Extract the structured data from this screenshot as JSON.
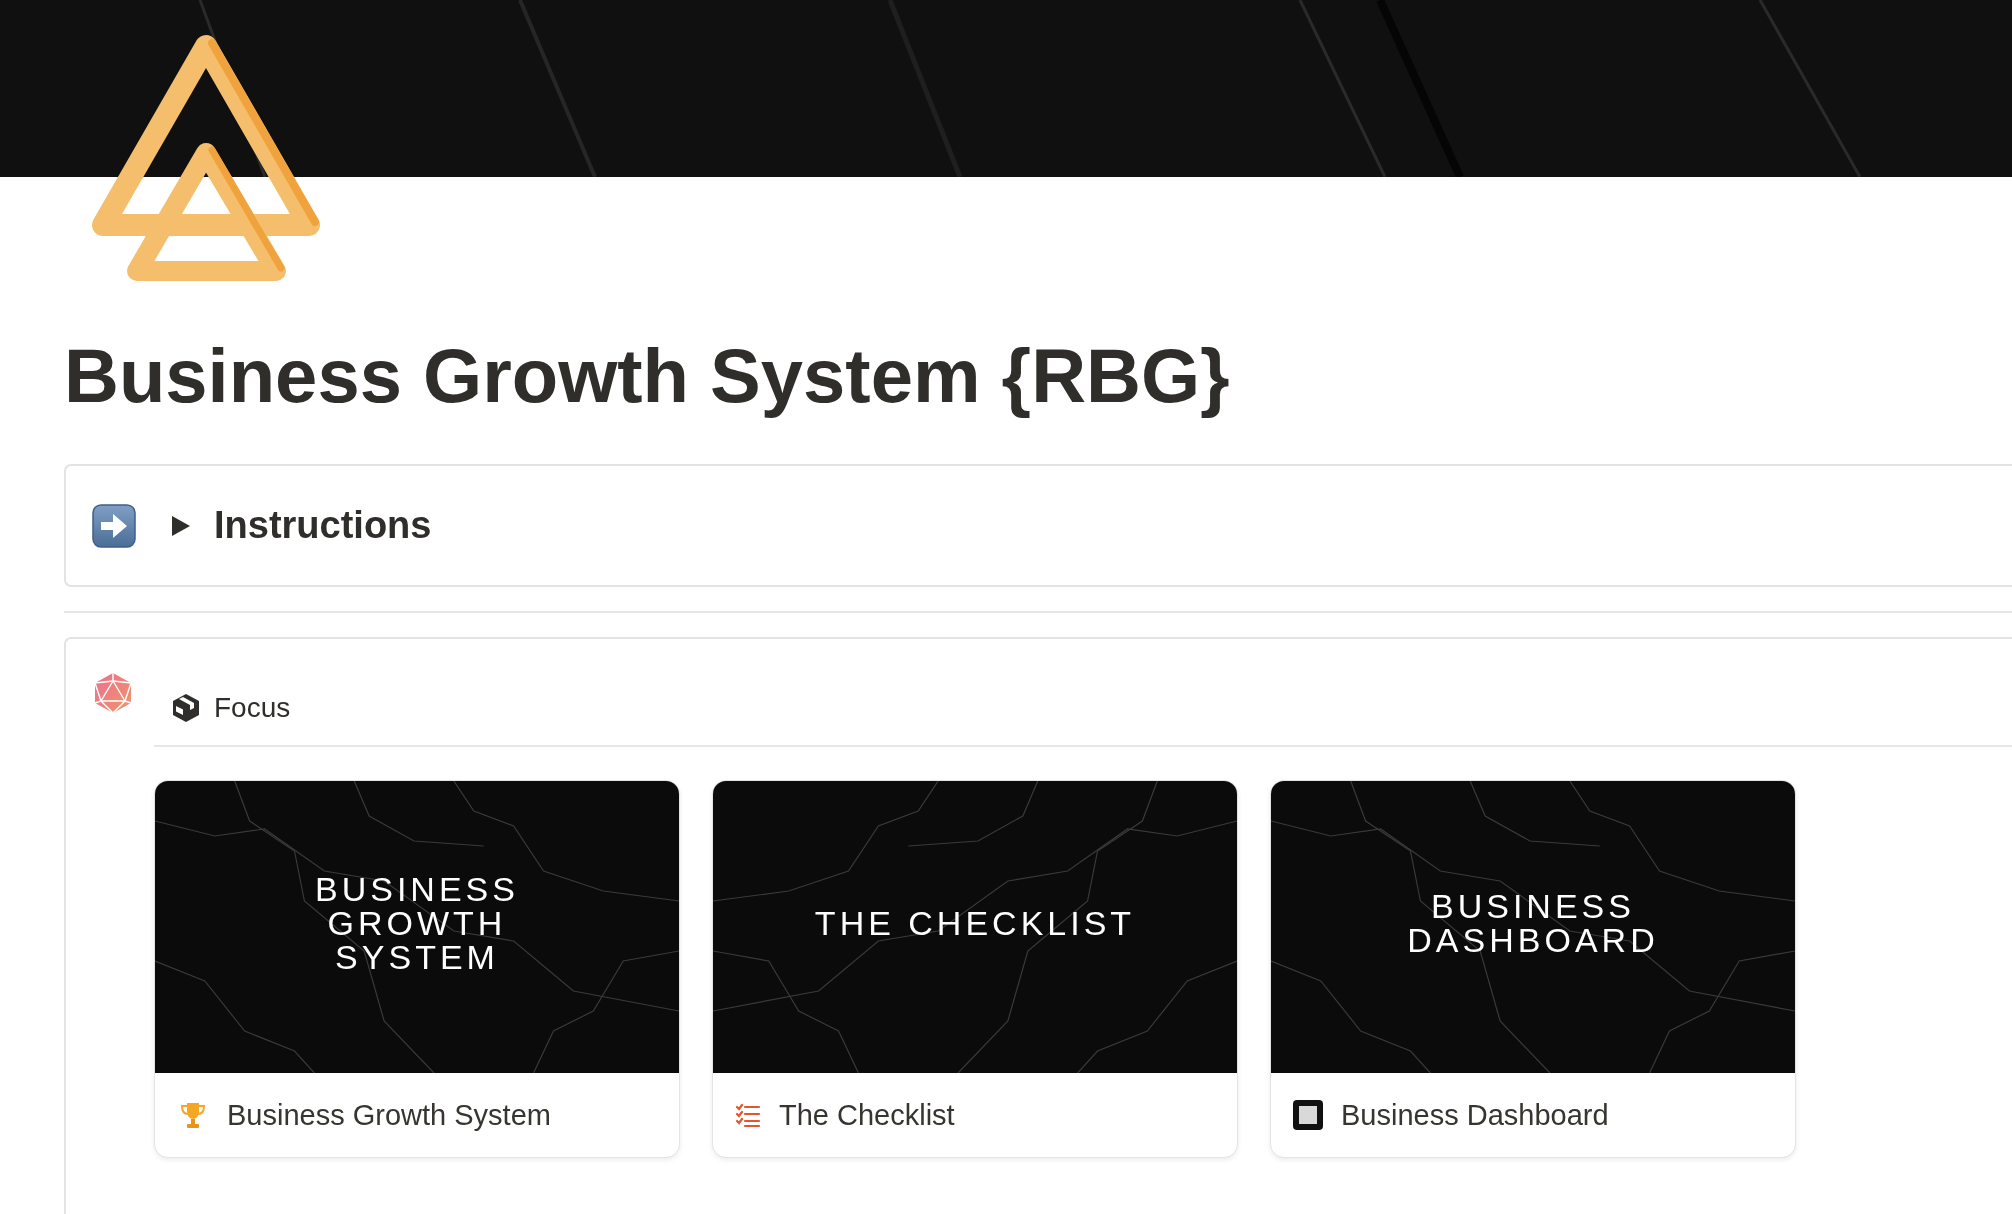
{
  "page": {
    "title": "Business Growth System {RBG}"
  },
  "instructions": {
    "title": "Instructions",
    "expanded": false
  },
  "focus": {
    "view_title": "Focus",
    "cards": [
      {
        "cover_text": "BUSINESS GROWTH SYSTEM",
        "title": "Business Growth System"
      },
      {
        "cover_text": "THE CHECKLIST",
        "title": "The Checklist"
      },
      {
        "cover_text": "BUSINESS DASHBOARD",
        "title": "Business Dashboard"
      }
    ]
  }
}
